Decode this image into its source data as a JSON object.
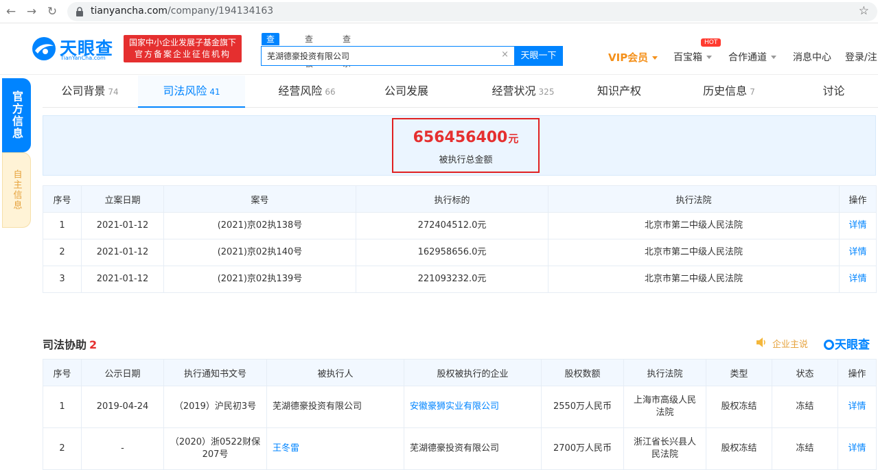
{
  "browser": {
    "url_host": "tianyancha.com",
    "url_path": "/company/194134163"
  },
  "header": {
    "logo_text": "天眼查",
    "logo_sub": "TianYanCha.com",
    "badge_line1": "国家中小企业发展子基金旗下",
    "badge_line2": "官方备案企业征信机构",
    "search_tabs": [
      "查公司",
      "查老板",
      "查关系"
    ],
    "search_value": "芜湖德豪投资有限公司",
    "search_button": "天眼一下",
    "nav": {
      "vip": "VIP会员",
      "baibaoxiang": "百宝箱",
      "hot": "HOT",
      "cooperation": "合作通道",
      "messages": "消息中心",
      "login": "登录/注"
    }
  },
  "side_tabs": {
    "official": "官方信息",
    "self": "自主信息"
  },
  "tabs": [
    {
      "label": "公司背景",
      "count": "74"
    },
    {
      "label": "司法风险",
      "count": "41"
    },
    {
      "label": "经营风险",
      "count": "66"
    },
    {
      "label": "公司发展",
      "count": ""
    },
    {
      "label": "经营状况",
      "count": "325"
    },
    {
      "label": "知识产权",
      "count": ""
    },
    {
      "label": "历史信息",
      "count": "7"
    },
    {
      "label": "讨论",
      "count": ""
    }
  ],
  "summary": {
    "amount": "656456400",
    "unit": "元",
    "label": "被执行总金额"
  },
  "executed_table": {
    "headers": [
      "序号",
      "立案日期",
      "案号",
      "执行标的",
      "执行法院",
      "操作"
    ],
    "rows": [
      [
        "1",
        "2021-01-12",
        "(2021)京02执138号",
        "272404512.0元",
        "北京市第二中级人民法院",
        "详情"
      ],
      [
        "2",
        "2021-01-12",
        "(2021)京02执140号",
        "162958656.0元",
        "北京市第二中级人民法院",
        "详情"
      ],
      [
        "3",
        "2021-01-12",
        "(2021)京02执139号",
        "221093232.0元",
        "北京市第二中级人民法院",
        "详情"
      ]
    ]
  },
  "assist": {
    "title": "司法协助",
    "count": "2",
    "self_say": "企业主说",
    "brand": "天眼查",
    "headers": [
      "序号",
      "公示日期",
      "执行通知书文号",
      "被执行人",
      "股权被执行的企业",
      "股权数额",
      "执行法院",
      "类型",
      "状态",
      "操作"
    ],
    "rows": [
      [
        "1",
        "2019-04-24",
        "（2019）沪民初3号",
        "芜湖德豪投资有限公司",
        "安徽豪狮实业有限公司",
        "2550万人民币",
        "上海市高级人民法院",
        "股权冻结",
        "冻结",
        "详情"
      ],
      [
        "2",
        "-",
        "（2020）浙0522财保207号",
        "王冬雷",
        "芜湖德豪投资有限公司",
        "2700万人民币",
        "浙江省长兴县人民法院",
        "股权冻结",
        "冻结",
        "详情"
      ]
    ]
  },
  "colors": {
    "brand_blue": "#0084ff",
    "alert_red": "#e52f2f",
    "vip_orange": "#f4901a"
  }
}
